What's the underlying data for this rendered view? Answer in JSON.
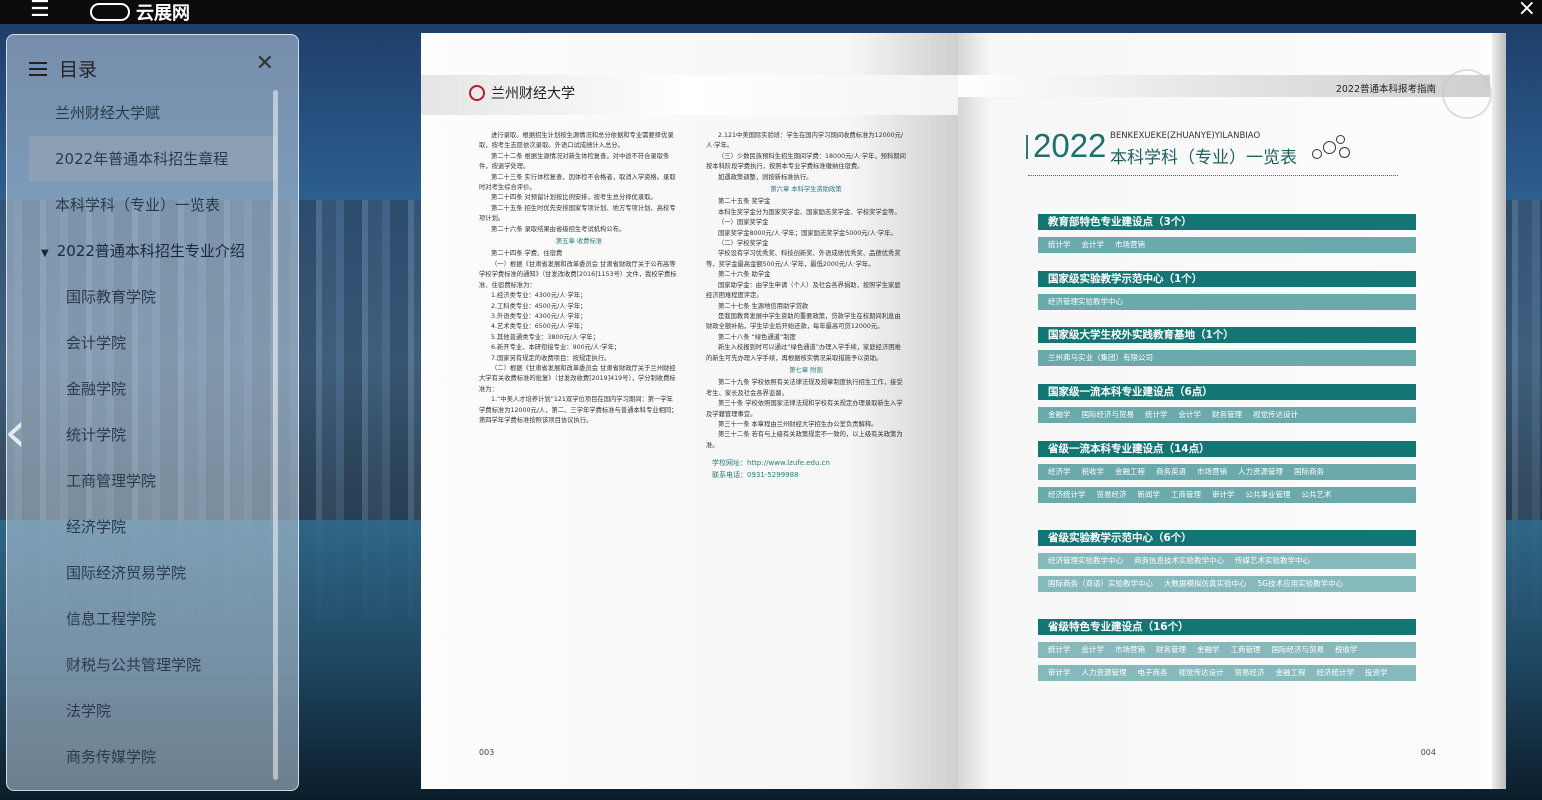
{
  "topbar": {
    "brand": "云展网"
  },
  "sidebar": {
    "title": "目录",
    "items": [
      {
        "label": "兰州财经大学赋",
        "type": "item"
      },
      {
        "label": "2022年普通本科招生章程",
        "type": "active"
      },
      {
        "label": "本科学科（专业）一览表",
        "type": "item"
      },
      {
        "label": "2022普通本科招生专业介绍",
        "type": "group"
      },
      {
        "label": "国际教育学院",
        "type": "sub"
      },
      {
        "label": "会计学院",
        "type": "sub"
      },
      {
        "label": "金融学院",
        "type": "sub"
      },
      {
        "label": "统计学院",
        "type": "sub"
      },
      {
        "label": "工商管理学院",
        "type": "sub"
      },
      {
        "label": "经济学院",
        "type": "sub"
      },
      {
        "label": "国际经济贸易学院",
        "type": "sub"
      },
      {
        "label": "信息工程学院",
        "type": "sub"
      },
      {
        "label": "财税与公共管理学院",
        "type": "sub"
      },
      {
        "label": "法学院",
        "type": "sub"
      },
      {
        "label": "商务传媒学院",
        "type": "sub"
      }
    ]
  },
  "left_page": {
    "logo_text": "兰州财经大学",
    "page_number": "003",
    "col_a": [
      "进行录取。根据招生计划按生源情况和总分依据和专业需要择优录取，按考生志愿依次录取。外语口试成绩计入总分。",
      "第二十二条 根据生源情况对新生体检复查。对中途不符合录取条件，按退学处理。",
      "第二十三条 实行体检复查，因体检不合格者，取消入学资格。录取时对考生综合评价。",
      "第二十四条 对预留计划按比例安排，按考生总分择优录取。",
      "第二十五条 招生时优先安排国家专项计划、地方专项计划、高校专项计划。",
      "第二十六条 录取结果由省级招生考试机构公布。",
      "第五章 收费标准",
      "第二十四条 学费、住宿费",
      "（一）根据《甘肃省发展和改革委员会 甘肃省财政厅关于公布高等学校学费标准的通知》（甘发改收费[2016]1153号）文件，我校学费标准、住宿费标准为：",
      "1.经济类专业：4300元/人·学年；",
      "2.工科类专业：4500元/人·学年；",
      "3.外语类专业：4300元/人·学年；",
      "4.艺术类专业：6500元/人·学年；",
      "5.其他普通类专业：3800元/人·学年；",
      "6.新开专业、本研衔接专业：900元/人·学年；",
      "7.国家另有规定的收费项目：按规定执行。",
      "（二）根据《甘肃省发展和改革委员会 甘肃省财政厅关于兰州财经大学有关收费标准的批复》（甘发改收费[2019]419号），学分制收费标准为：",
      "1.“中美人才培养计划”121双学位项目在国内学习期间：第一学年学费标准为12000元/人，第二、三学年学费标准与普通本科专业相同；第四学年学费标准按照该项目协议执行。"
    ],
    "col_b": [
      "2.121中美国际实验班：学生在国内学习期间收费标准为12000元/人·学年。",
      "（三）少数民族预科生招生期间学费：18000元/人·学年，预科期间按本科阶段学费执行，按照本专业学费标准缴纳住宿费。",
      "如遇政策调整，则按新标准执行。",
      "第六章 本科学生资助政策",
      "第二十五条 奖学金",
      "本科生奖学金分为国家奖学金、国家励志奖学金、学校奖学金等。",
      "（一）国家奖学金",
      "国家奖学金8000元/人·学年；国家励志奖学金5000元/人·学年。",
      "（二）学校奖学金",
      "学校设有学习优秀奖、科技创新奖、外语成绩优秀奖、品德优秀奖等，奖学金最高金额500元/人·学年，最低2000元/人·学年。",
      "第二十六条 助学金",
      "国家助学金：由学生申请（个人）及社会各界捐助，按照学生家庭经济困难程度评定。",
      "第二十七条 生源地信用助学贷款",
      "是我国教育发展中学生资助的重要政策，贷款学生在校期间利息由财政全额补贴，学生毕业后开始还款，每年最高可贷12000元。",
      "第二十八条 “绿色通道”制度",
      "新生入校报到时可以通过“绿色通道”办理入学手续，家庭经济困难的新生可先办理入学手续，再根据核实情况采取措施予以资助。",
      "第七章 附则",
      "第二十九条 学校依照有关法律法规及规章制度执行招生工作，接受考生、家长及社会各界监督。",
      "第三十条 学校依照国家法律法规和学校有关规定办理录取新生入学及学籍管理事宜。",
      "第三十一条 本章程由兰州财经大学招生办公室负责解释。",
      "第三十二条 若有与上级有关政策规定不一致的，以上级有关政策为准。"
    ],
    "website": "学校网址：http://www.lzufe.edu.cn",
    "phone": "联系电话：0931-5299988"
  },
  "right_page": {
    "header": "2022普通本科报考指南",
    "title_year": "2022",
    "title_pinyin": "BENKEXUEKE(ZHUANYE)YILANBIAO",
    "title_main": "本科学科（专业）一览表",
    "page_number": "004",
    "categories": [
      {
        "heading": "教育部特色专业建设点（3个）",
        "rows": [
          [
            "统计学",
            "会计学",
            "市场营销"
          ]
        ]
      },
      {
        "heading": "国家级实验教学示范中心（1个）",
        "rows": [
          [
            "经济管理实验教学中心"
          ]
        ]
      },
      {
        "heading": "国家级大学生校外实践教育基地（1个）",
        "rows": [
          [
            "兰州弗马实业（集团）有限公司"
          ]
        ]
      },
      {
        "heading": "国家级一流本科专业建设点（6点）",
        "rows": [
          [
            "金融学",
            "国际经济与贸易",
            "统计学",
            "会计学",
            "财务管理",
            "视觉传达设计"
          ]
        ]
      },
      {
        "heading": "省级一流本科专业建设点（14点）",
        "rows": [
          [
            "经济学",
            "税收学",
            "金融工程",
            "商务英语",
            "市场营销",
            "人力资源管理",
            "国际商务"
          ],
          [
            "经济统计学",
            "贸易经济",
            "新闻学",
            "工商管理",
            "审计学",
            "公共事业管理",
            "公共艺术"
          ]
        ]
      },
      {
        "heading": "省级实验教学示范中心（6个）",
        "rows": [
          [
            "经济管理实验教学中心",
            "商务信息技术实验教学中心",
            "传媒艺术实验教学中心"
          ],
          [
            "国际商务（双语）实验教学中心",
            "大数据模拟仿真实验中心",
            "5G技术应用实验教学中心"
          ]
        ]
      },
      {
        "heading": "省级特色专业建设点（16个）",
        "rows": [
          [
            "统计学",
            "会计学",
            "市场营销",
            "财务管理",
            "金融学",
            "工商管理",
            "国际经济与贸易",
            "税收学"
          ],
          [
            "审计学",
            "人力资源管理",
            "电子商务",
            "视觉传达设计",
            "贸易经济",
            "金融工程",
            "经济统计学",
            "投资学"
          ]
        ]
      }
    ]
  }
}
